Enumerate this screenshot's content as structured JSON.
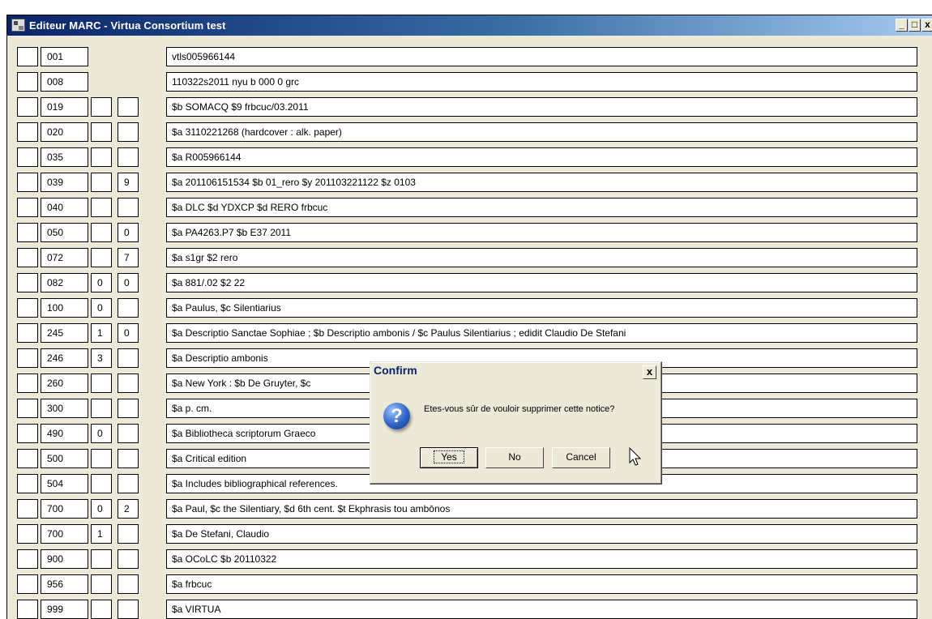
{
  "window": {
    "title": "Editeur MARC - Virtua Consortium test",
    "buttons": {
      "minimize": "_",
      "maximize": "□",
      "close": "x"
    }
  },
  "records": [
    {
      "tag": "001",
      "ind1": null,
      "ind2": null,
      "data": "vtls005966144"
    },
    {
      "tag": "008",
      "ind1": null,
      "ind2": null,
      "data": "110322s2011    nyu      b    000 0 grc"
    },
    {
      "tag": "019",
      "ind1": "",
      "ind2": "",
      "data": "$b SOMACQ $9 frbcuc/03.2011"
    },
    {
      "tag": "020",
      "ind1": "",
      "ind2": "",
      "data": "$a 3110221268 (hardcover : alk. paper)"
    },
    {
      "tag": "035",
      "ind1": "",
      "ind2": "",
      "data": "$a R005966144"
    },
    {
      "tag": "039",
      "ind1": "",
      "ind2": "9",
      "data": "$a 201106151534 $b 01_rero $y 201103221122 $z 0103"
    },
    {
      "tag": "040",
      "ind1": "",
      "ind2": "",
      "data": "$a DLC $d YDXCP $d RERO frbcuc"
    },
    {
      "tag": "050",
      "ind1": "",
      "ind2": "0",
      "data": "$a PA4263.P7 $b E37 2011"
    },
    {
      "tag": "072",
      "ind1": "",
      "ind2": "7",
      "data": "$a s1gr $2 rero"
    },
    {
      "tag": "082",
      "ind1": "0",
      "ind2": "0",
      "data": "$a 881/.02 $2 22"
    },
    {
      "tag": "100",
      "ind1": "0",
      "ind2": "",
      "data": "$a Paulus, $c Silentiarius"
    },
    {
      "tag": "245",
      "ind1": "1",
      "ind2": "0",
      "data": "$a Descriptio Sanctae Sophiae ; $b Descriptio ambonis / $c Paulus Silentiarius ; edidit Claudio De Stefani"
    },
    {
      "tag": "246",
      "ind1": "3",
      "ind2": "",
      "data": "$a Descriptio ambonis"
    },
    {
      "tag": "260",
      "ind1": "",
      "ind2": "",
      "data": "$a New York : $b De Gruyter, $c"
    },
    {
      "tag": "300",
      "ind1": "",
      "ind2": "",
      "data": "$a p. cm."
    },
    {
      "tag": "490",
      "ind1": "0",
      "ind2": "",
      "data": "$a Bibliotheca scriptorum Graeco"
    },
    {
      "tag": "500",
      "ind1": "",
      "ind2": "",
      "data": "$a Critical edition"
    },
    {
      "tag": "504",
      "ind1": "",
      "ind2": "",
      "data": "$a Includes bibliographical references."
    },
    {
      "tag": "700",
      "ind1": "0",
      "ind2": "2",
      "data": "$a Paul, $c the Silentiary, $d 6th cent. $t Ekphrasis tou ambōnos"
    },
    {
      "tag": "700",
      "ind1": "1",
      "ind2": "",
      "data": "$a De Stefani, Claudio"
    },
    {
      "tag": "900",
      "ind1": "",
      "ind2": "",
      "data": "$a OCoLC $b 20110322"
    },
    {
      "tag": "956",
      "ind1": "",
      "ind2": "",
      "data": "$a frbcuc"
    },
    {
      "tag": "999",
      "ind1": "",
      "ind2": "",
      "data": "$a VIRTUA"
    }
  ],
  "dialog": {
    "title": "Confirm",
    "close": "x",
    "icon": "question-icon",
    "message": "Etes-vous sûr de vouloir supprimer cette notice?",
    "buttons": {
      "yes": "Yes",
      "no": "No",
      "cancel": "Cancel"
    }
  }
}
